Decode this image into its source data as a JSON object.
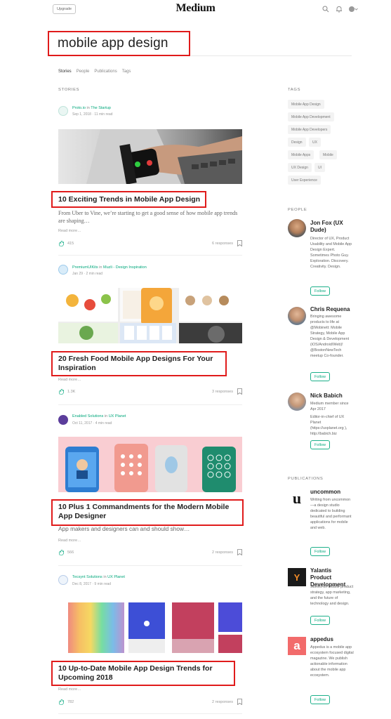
{
  "header": {
    "upgrade_label": "Upgrade",
    "logo": "Medium"
  },
  "search": {
    "query": "mobile app design"
  },
  "tabs": [
    {
      "label": "Stories"
    },
    {
      "label": "People"
    },
    {
      "label": "Publications"
    },
    {
      "label": "Tags"
    }
  ],
  "stories": {
    "heading": "STORIES",
    "posts": [
      {
        "author": "Proto.io",
        "connector": "in",
        "publication": "The Startup",
        "date": "Sep 1, 2018",
        "read_time": "11 min read",
        "title": "10 Exciting Trends in Mobile App Design",
        "excerpt": "From Uber to Vine, we’re starting to get a good sense of how mobile app trends are shaping…",
        "read_more": "Read more…",
        "claps": "415",
        "responses": "6 responses"
      },
      {
        "author": "PremiumUIKits",
        "connector": "in",
        "publication": "Muzli - Design Inspiration",
        "date": "Jan 29",
        "read_time": "2 min read",
        "title": "20 Fresh Food Mobile App Designs For Your Inspiration",
        "excerpt": "",
        "read_more": "Read more…",
        "claps": "1.3K",
        "responses": "3 responses"
      },
      {
        "author": "Enabled Solutions",
        "connector": "in",
        "publication": "UX Planet",
        "date": "Oct 11, 2017",
        "read_time": "4 min read",
        "title": "10 Plus 1 Commandments for the Modern Mobile App Designer",
        "excerpt": "App makers and designers can and should show…",
        "read_more": "Read more…",
        "claps": "566",
        "responses": "2 responses"
      },
      {
        "author": "Tecsynt Solutions",
        "connector": "in",
        "publication": "UX Planet",
        "date": "Dec 8, 2017",
        "read_time": "9 min read",
        "title": "10 Up-to-Date Mobile App Design Trends for Upcoming 2018",
        "excerpt": "",
        "read_more": "Read more…",
        "claps": "782",
        "responses": "2 responses"
      }
    ]
  },
  "tags": {
    "heading": "TAGS",
    "items": [
      "Mobile App Design",
      "Mobile App Development",
      "Mobile App Developers",
      "Design",
      "UX",
      "Mobile Apps",
      "Mobile",
      "UX Design",
      "UI",
      "User Experience"
    ]
  },
  "people": {
    "heading": "PEOPLE",
    "items": [
      {
        "name": "Jon Fox (UX Dude)",
        "bio": "Director of UX, Product Usability and Mobile App Design Expert. Sometimes Photo Guy. Exploration. Discovery. Creativity. Design.",
        "follow": "Follow"
      },
      {
        "name": "Chris Requena",
        "bio": "Bringing awesome products to life at @Mobinett: Mobile Strategy, Mobile App Design & Development (iOS/Android/Web)! @BostonNewTech meetup Co-founder.",
        "follow": "Follow"
      },
      {
        "name": "Nick Babich",
        "bio": "Medium member since Apr 2017",
        "bio2": "Editor-in-chief of UX Planet (https://uxplanet.org ), http://babich.biz",
        "follow": "Follow"
      }
    ]
  },
  "publications": {
    "heading": "PUBLICATIONS",
    "items": [
      {
        "name": "uncommon",
        "logo_letter": "u",
        "bio": "Writing from uncommon—a design studio dedicated to building beautiful and performant applications for mobile and web.",
        "follow": "Follow"
      },
      {
        "name": "Yalantis Product Development",
        "logo_letter": "Y",
        "bio": "Stories on mobile product strategy, app marketing, and the future of technology and design.",
        "follow": "Follow"
      },
      {
        "name": "appedus",
        "logo_letter": "a",
        "bio": "Appedus is a mobile app ecosystem focused digital magazine. We publish actionable information about the mobile app ecosystem.",
        "follow": "Follow"
      }
    ]
  },
  "colors": {
    "accent": "#03a87c",
    "highlight": "#e01b1b"
  }
}
